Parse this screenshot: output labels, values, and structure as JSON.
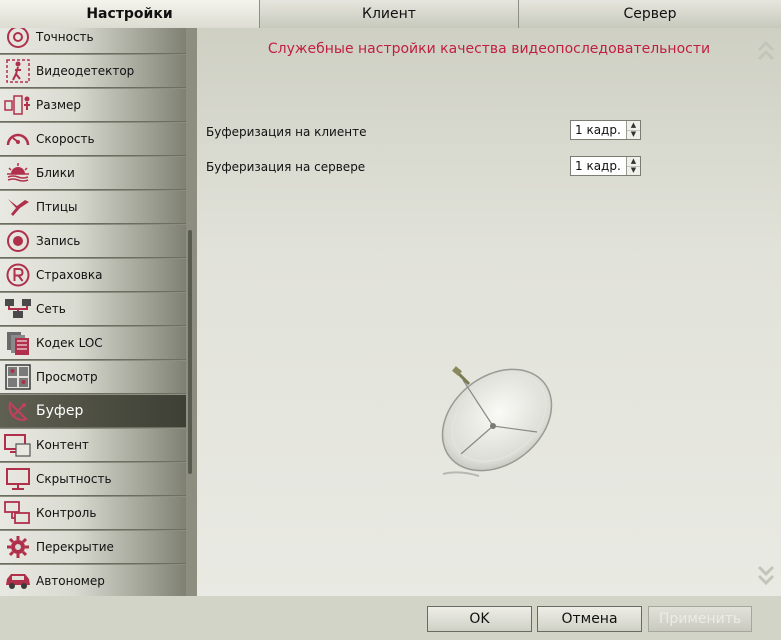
{
  "tabs": [
    {
      "label": "Настройки"
    },
    {
      "label": "Клиент"
    },
    {
      "label": "Сервер"
    }
  ],
  "sidebar": {
    "items": [
      {
        "label": "Точность",
        "icon": "accuracy-icon"
      },
      {
        "label": "Видеодетектор",
        "icon": "motion-detector-icon"
      },
      {
        "label": "Размер",
        "icon": "size-icon"
      },
      {
        "label": "Скорость",
        "icon": "speedometer-icon"
      },
      {
        "label": "Блики",
        "icon": "glare-icon"
      },
      {
        "label": "Птицы",
        "icon": "bird-icon"
      },
      {
        "label": "Запись",
        "icon": "record-icon"
      },
      {
        "label": "Страховка",
        "icon": "registered-icon"
      },
      {
        "label": "Сеть",
        "icon": "network-icon"
      },
      {
        "label": "Кодек LOC",
        "icon": "codec-icon"
      },
      {
        "label": "Просмотр",
        "icon": "view-icon"
      },
      {
        "label": "Буфер",
        "icon": "satellite-dish-icon"
      },
      {
        "label": "Контент",
        "icon": "content-icon"
      },
      {
        "label": "Скрытность",
        "icon": "monitor-icon"
      },
      {
        "label": "Контроль",
        "icon": "control-icon"
      },
      {
        "label": "Перекрытие",
        "icon": "gear-icon"
      },
      {
        "label": "Автономер",
        "icon": "car-icon"
      }
    ],
    "active_index": 11
  },
  "main": {
    "title": "Служебные настройки качества видеопоследовательности",
    "client_buffer_label": "Буферизация на клиенте",
    "client_buffer_value": "1 кадр.",
    "server_buffer_label": "Буферизация на сервере",
    "server_buffer_value": "1 кадр."
  },
  "buttons": {
    "ok": "OK",
    "cancel": "Отмена",
    "apply": "Применить"
  },
  "colors": {
    "title": "#c02040",
    "icon": "#b0304c"
  }
}
